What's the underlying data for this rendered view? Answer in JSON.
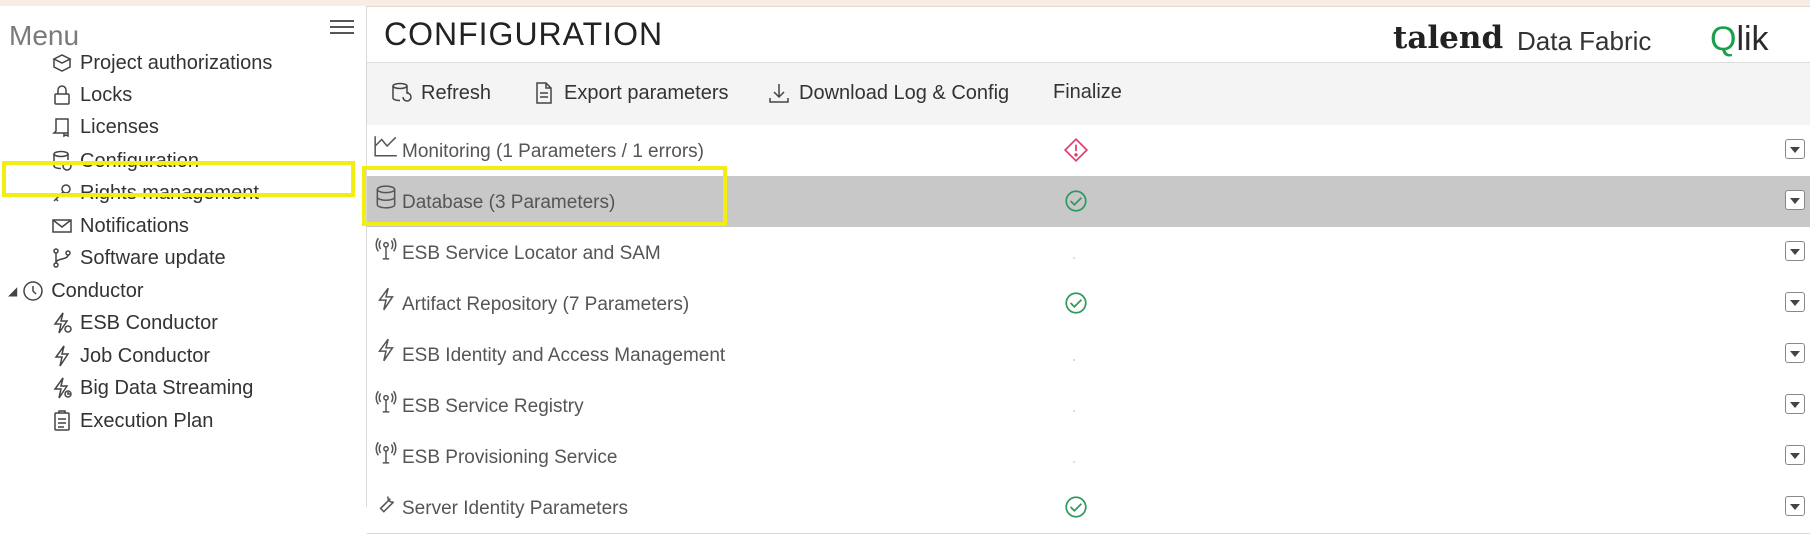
{
  "menu": {
    "title": "Menu",
    "items": [
      {
        "label": "Project authorizations",
        "icon": "project-authorizations-icon"
      },
      {
        "label": "Locks",
        "icon": "lock-icon"
      },
      {
        "label": "Licenses",
        "icon": "license-icon"
      },
      {
        "label": "Configuration",
        "icon": "configuration-icon"
      },
      {
        "label": "Rights management",
        "icon": "key-icon"
      },
      {
        "label": "Notifications",
        "icon": "envelope-icon"
      },
      {
        "label": "Software update",
        "icon": "software-update-icon"
      }
    ],
    "group": {
      "label": "Conductor",
      "icon": "clock-icon"
    },
    "group_items": [
      {
        "label": "ESB Conductor",
        "icon": "esb-conductor-icon"
      },
      {
        "label": "Job Conductor",
        "icon": "job-conductor-icon"
      },
      {
        "label": "Big Data Streaming",
        "icon": "big-data-streaming-icon"
      },
      {
        "label": "Execution Plan",
        "icon": "execution-plan-icon"
      }
    ]
  },
  "header": {
    "title": "CONFIGURATION",
    "brand_talend": "talend",
    "brand_fabric": "Data Fabric",
    "brand_qlik_q": "Q",
    "brand_qlik_rest": "lik"
  },
  "toolbar": {
    "refresh": "Refresh",
    "export": "Export parameters",
    "download": "Download Log & Config",
    "finalize": "Finalize"
  },
  "rows": [
    {
      "label": "Monitoring (1 Parameters / 1 errors)",
      "status": "error"
    },
    {
      "label": "Database (3 Parameters)",
      "status": "ok"
    },
    {
      "label": "ESB Service Locator and SAM",
      "status": "none"
    },
    {
      "label": "Artifact Repository (7 Parameters)",
      "status": "ok"
    },
    {
      "label": "ESB Identity and Access Management",
      "status": "none"
    },
    {
      "label": "ESB Service Registry",
      "status": "none"
    },
    {
      "label": "ESB Provisioning Service",
      "status": "none"
    },
    {
      "label": "Server Identity Parameters",
      "status": "ok"
    }
  ],
  "colors": {
    "highlight": "#f3ee12",
    "ok": "#2e9a5c",
    "error": "#e0426f",
    "selected_row": "#c8c8c8"
  }
}
